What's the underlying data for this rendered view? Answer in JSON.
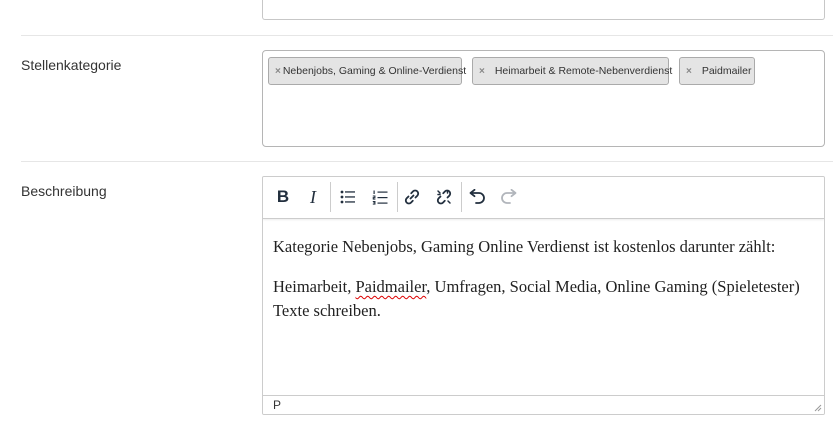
{
  "category_row": {
    "label": "Stellenkategorie",
    "tags": [
      {
        "label": "Nebenjobs, Gaming & Online-Verdienst",
        "remove": "×"
      },
      {
        "label": "Heimarbeit & Remote-Nebenverdienst",
        "remove": "×"
      },
      {
        "label": "Paidmailer",
        "remove": "×"
      }
    ]
  },
  "description_row": {
    "label": "Beschreibung",
    "toolbar": {
      "bold": "B",
      "italic": "I",
      "icons": [
        "bold-icon",
        "italic-icon",
        "bullet-list-icon",
        "numbered-list-icon",
        "link-icon",
        "unlink-icon",
        "undo-icon",
        "redo-icon"
      ]
    },
    "content": {
      "paragraph1": "Kategorie Nebenjobs, Gaming Online Verdienst ist kostenlos darunter zählt:",
      "paragraph2_before": "Heimarbeit, ",
      "paragraph2_misspelled": "Paidmailer",
      "paragraph2_after": ", Umfragen, Social Media, Online Gaming (Spieletester) Texte schreiben."
    },
    "statusbar": {
      "path": "P"
    }
  },
  "colors": {
    "tag_bg": "#e4e4e4",
    "tag_border": "#aaaaaa",
    "spellcheck": "#dd0000",
    "toolbar_icon": "#222f3e"
  }
}
